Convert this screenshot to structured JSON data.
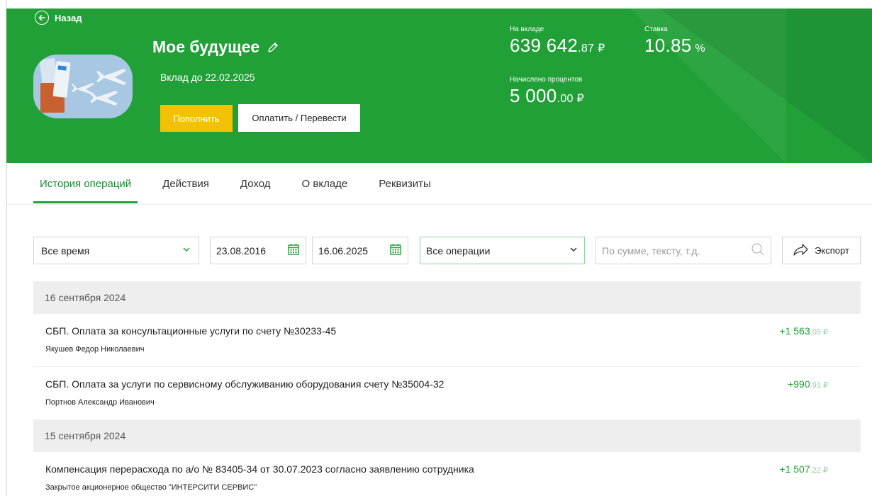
{
  "header": {
    "back_label": "Назад",
    "title": "Мое будущее",
    "until": "Вклад до 22.02.2025",
    "fill_button": "Пополнить",
    "pay_button": "Оплатить / Перевести",
    "balance": {
      "label": "На вкладе",
      "main": "639 642",
      "fraction": ".87 ₽"
    },
    "rate": {
      "label": "Ставка",
      "main": "10.85",
      "fraction": " %"
    },
    "interest": {
      "label": "Начислено процентов",
      "main": "5 000",
      "fraction": ".00 ₽"
    }
  },
  "tabs": [
    {
      "label": "История операций",
      "active": true
    },
    {
      "label": "Действия"
    },
    {
      "label": "Доход"
    },
    {
      "label": "О вкладе"
    },
    {
      "label": "Реквизиты"
    }
  ],
  "filters": {
    "period": "Все время",
    "date_from": "23.08.2016",
    "date_to": "16.06.2025",
    "operations": "Все операции",
    "search_placeholder": "По сумме, тексту, т.д.",
    "export_label": "Экспорт"
  },
  "groups": [
    {
      "date": "16 сентября 2024",
      "operations": [
        {
          "title": "СБП. Оплата за консультационные услуги по счету №30233-45",
          "counterparty": "Якушев Федор Николаевич",
          "amount_main": "+1 563",
          "amount_cents": ".05 ₽"
        },
        {
          "title": "СБП. Оплата за услуги по сервисному обслуживанию оборудования счету №35004-32",
          "counterparty": "Портнов Александр Иванович",
          "amount_main": "+990",
          "amount_cents": ".91 ₽"
        }
      ]
    },
    {
      "date": "15 сентября 2024",
      "operations": [
        {
          "title": "Компенсация перерасхода по а/о № 83405-34 от 30.07.2023 согласно заявлению сотрудника",
          "counterparty": "Закрытое акционерное общество \"ИНТЕРСИТИ СЕРВИС\"",
          "amount_main": "+1 507",
          "amount_cents": ".22 ₽"
        }
      ]
    }
  ],
  "colors": {
    "brand_green": "#21a038",
    "accent_yellow": "#f2c200",
    "amount_green": "#21a038"
  },
  "icons": [
    "back-arrow-icon",
    "edit-pencil-icon",
    "chevron-down-icon",
    "calendar-icon",
    "search-icon",
    "share-arrow-icon"
  ]
}
